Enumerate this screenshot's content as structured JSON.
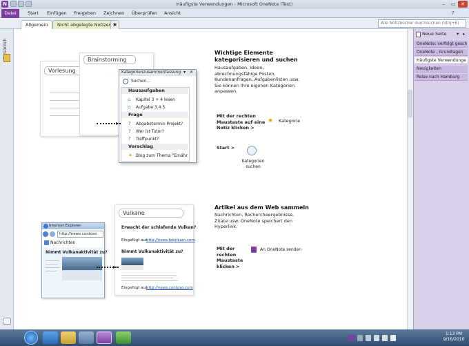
{
  "window": {
    "title": "Häufigste Verwendungen - Microsoft OneNote (Test)",
    "app_icon": "N",
    "minimize": "–",
    "maximize": "▭",
    "close": "✕"
  },
  "ribbon": {
    "file": "Datei",
    "tabs": [
      "Start",
      "Einfügen",
      "Freigeben",
      "Zeichnen",
      "Überprüfen",
      "Ansicht"
    ]
  },
  "sections": {
    "tab1": "Allgemein",
    "tab2": "Nicht abgelegte Notizen",
    "add": "✱"
  },
  "search": {
    "placeholder": "Alle Notizbücher durchsuchen (Strg+E)"
  },
  "notebook": {
    "label": "Persönlich"
  },
  "pages": {
    "new_page": "Neue Seite",
    "items": [
      "OneNote: verfolgt gesch",
      "OneNote - Grundlagen",
      "Häufigste Verwendunge",
      "Neuigkeiten",
      "Reise nach Hamburg"
    ]
  },
  "section1": {
    "heading": "Wichtige Elemente kategorisieren und suchen",
    "body": "Hausaufgaben, Ideen, abrechnungsfähige Posten, Kundenanfragen, Aufgabenlisten usw. Sie können Ihre eigenen Kategorien anpassen.",
    "rightclick": "Mit der rechten Maustaste auf eine Notiz klicken >",
    "category": "Kategorie",
    "start": "Start >",
    "find_categories": "Kategorien suchen",
    "card_vorlesung": "Vorlesung",
    "card_brainstorming": "Brainstorming",
    "panel_title": "Kategorienzusammenfassung",
    "panel_search": "Suchen...",
    "grp1": "Hausaufgaben",
    "g1a": "Kapitel 3 + 4 lesen",
    "g1b": "Aufgabe 3.4.5",
    "grp2": "Frage",
    "g2a": "Abgabetermin Projekt?",
    "g2b": "Wer ist Tutor?",
    "g2c": "Treffpunkt?",
    "grp3": "Vorschlag",
    "g3a": "Blog zum Thema \"Emähr"
  },
  "section2": {
    "heading": "Artikel aus dem Web sammeln",
    "body": "Nachrichten, Rechercheergebnisse, Zitate usw. OneNote speichert den Hyperlink.",
    "rightclick": "Mit der rechten Maustaste klicken >",
    "send": "An OneNote senden",
    "card_title": "Vulkane",
    "q1": "Erwacht der schlafende Vulkan?",
    "ins1": "Eingefügt aus:",
    "link1": "http://news.fabrikam.com",
    "q2": "Nimmt Vulkanaktivität zu?",
    "ins2": "Eingefügt aus:",
    "link2": "http://news.contoso.com",
    "ie_title": "Internet Explorer",
    "ie_url": "http://news.contoso",
    "ie_tab": "Nachrichten",
    "ie_head": "Nimmt Vulkanaktivität zu?"
  },
  "clock": {
    "time": "1:13 PM",
    "date": "9/16/2010"
  },
  "colors": {
    "accent": "#7b3fa0",
    "pages_bg": "#d8cfe9"
  }
}
